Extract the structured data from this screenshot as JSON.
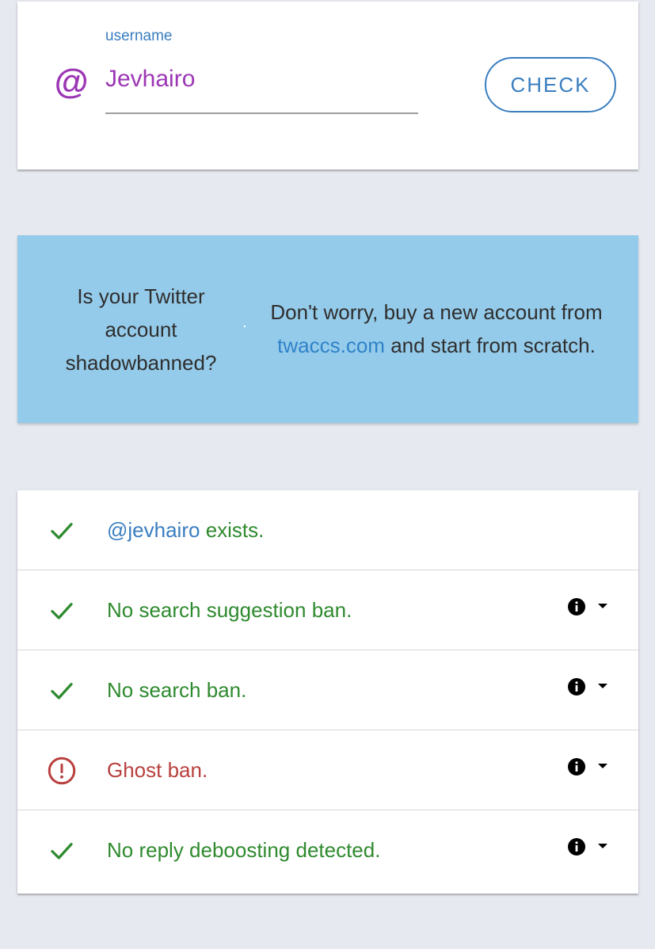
{
  "search": {
    "label": "username",
    "at_symbol": "@",
    "value": "Jevhairo",
    "check_label": "CHECK",
    "colors": {
      "accent": "#3a7ec0",
      "input_text": "#9c36b5"
    }
  },
  "ad": {
    "question": "Is your Twitter account shadowbanned?",
    "offer_prefix": "Don't worry, buy a new account from",
    "link_text": "twaccs.com",
    "offer_suffix": "and start from scratch.",
    "background": "#95cbea"
  },
  "results": {
    "rows": [
      {
        "status": "ok",
        "icon": "check-icon",
        "handle": "@jevhairo",
        "text": "exists.",
        "has_details": false
      },
      {
        "status": "ok",
        "icon": "check-icon",
        "text": "No search suggestion ban.",
        "has_details": true
      },
      {
        "status": "ok",
        "icon": "check-icon",
        "text": "No search ban.",
        "has_details": true
      },
      {
        "status": "bad",
        "icon": "alert-circle-icon",
        "text": "Ghost ban.",
        "has_details": true
      },
      {
        "status": "ok",
        "icon": "check-icon",
        "text": "No reply deboosting detected.",
        "has_details": true
      }
    ],
    "colors": {
      "ok": "#2f8a2f",
      "bad": "#b8403e"
    }
  }
}
